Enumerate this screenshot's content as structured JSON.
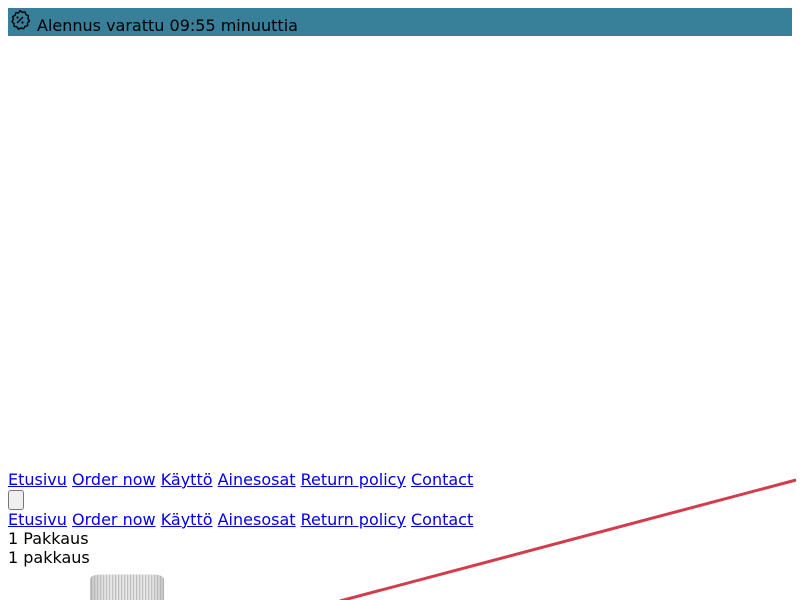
{
  "promo": {
    "text": "Alennus varattu 09:55 minuuttia",
    "icon": "discount-badge-icon",
    "background": "#387f9a"
  },
  "nav": {
    "items": [
      {
        "label": "Etusivu"
      },
      {
        "label": "Order now"
      },
      {
        "label": "Käyttö"
      },
      {
        "label": "Ainesosat"
      },
      {
        "label": "Return policy"
      },
      {
        "label": "Contact"
      }
    ]
  },
  "package": {
    "title": "1 Pakkaus",
    "subtitle": "1 pakkaus"
  },
  "colors": {
    "link": "#0000ee",
    "stripe": "#d23c4b"
  }
}
